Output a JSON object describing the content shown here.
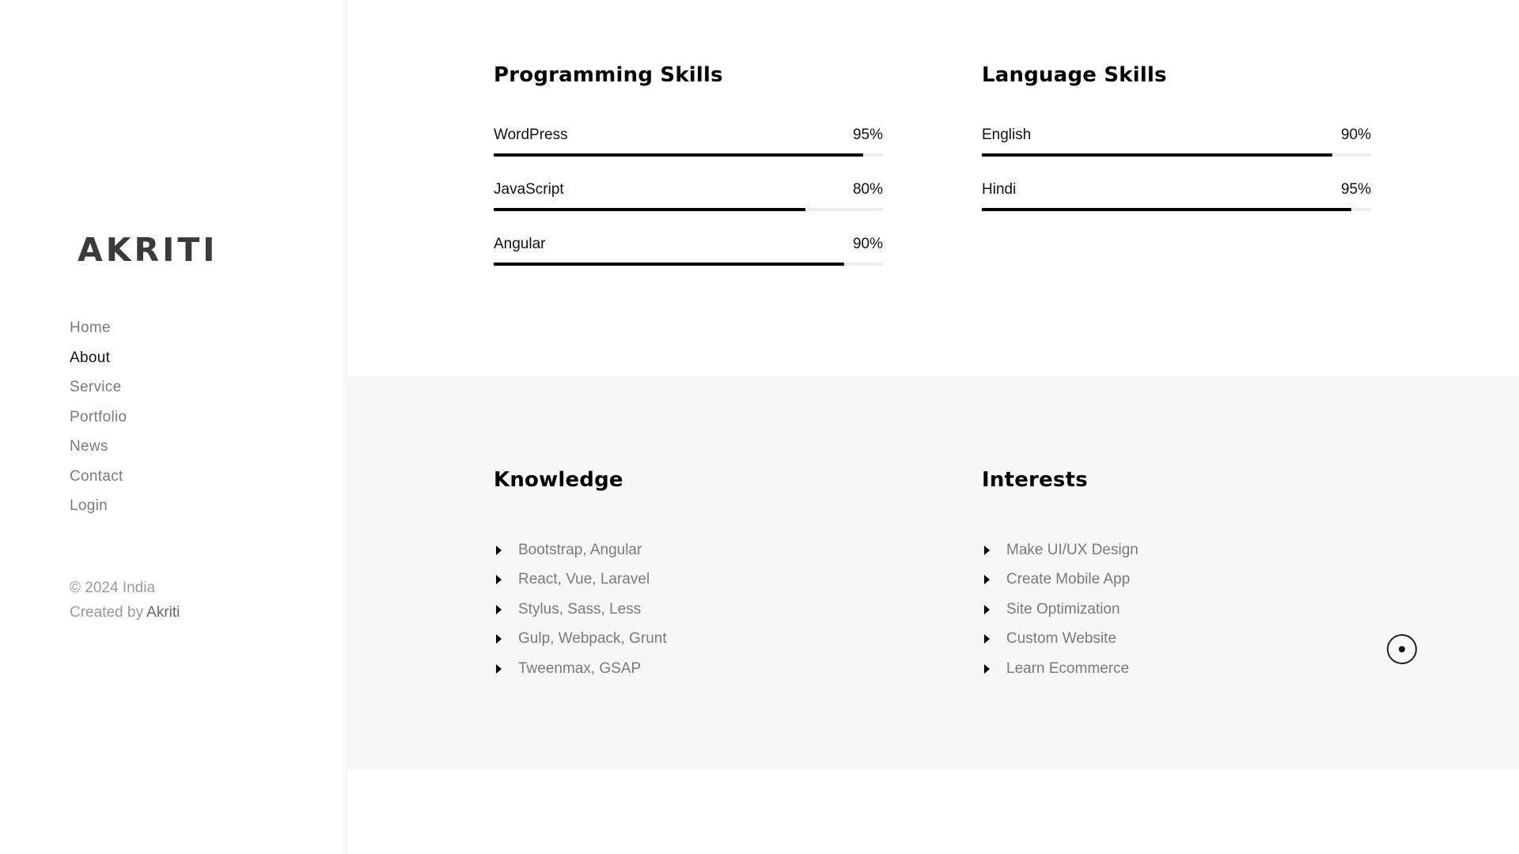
{
  "sidebar": {
    "logo": "AKRITI",
    "nav": [
      {
        "label": "Home",
        "active": false
      },
      {
        "label": "About",
        "active": true
      },
      {
        "label": "Service",
        "active": false
      },
      {
        "label": "Portfolio",
        "active": false
      },
      {
        "label": "News",
        "active": false
      },
      {
        "label": "Contact",
        "active": false
      },
      {
        "label": "Login",
        "active": false
      }
    ],
    "copyright": "© 2024 India",
    "created_by_prefix": "Created by ",
    "created_by_name": "Akriti"
  },
  "skills": {
    "programming": {
      "title": "Programming Skills",
      "items": [
        {
          "name": "WordPress",
          "percent_label": "95%",
          "value": 95
        },
        {
          "name": "JavaScript",
          "percent_label": "80%",
          "value": 80
        },
        {
          "name": "Angular",
          "percent_label": "90%",
          "value": 90
        }
      ]
    },
    "language": {
      "title": "Language Skills",
      "items": [
        {
          "name": "English",
          "percent_label": "90%",
          "value": 90
        },
        {
          "name": "Hindi",
          "percent_label": "95%",
          "value": 95
        }
      ]
    }
  },
  "knowledge": {
    "title": "Knowledge",
    "items": [
      "Bootstrap, Angular",
      "React, Vue, Laravel",
      "Stylus, Sass, Less",
      "Gulp, Webpack, Grunt",
      "Tweenmax, GSAP"
    ]
  },
  "interests": {
    "title": "Interests",
    "items": [
      "Make UI/UX Design",
      "Create Mobile App",
      "Site Optimization",
      "Custom Website",
      "Learn Ecommerce"
    ]
  },
  "colors": {
    "accent": "#000000",
    "muted_text": "#7a7a7a",
    "section_bg": "#f7f7f7"
  },
  "icons": {
    "list_bullet": "caret-right-icon",
    "cursor": "cursor-ring-icon"
  }
}
